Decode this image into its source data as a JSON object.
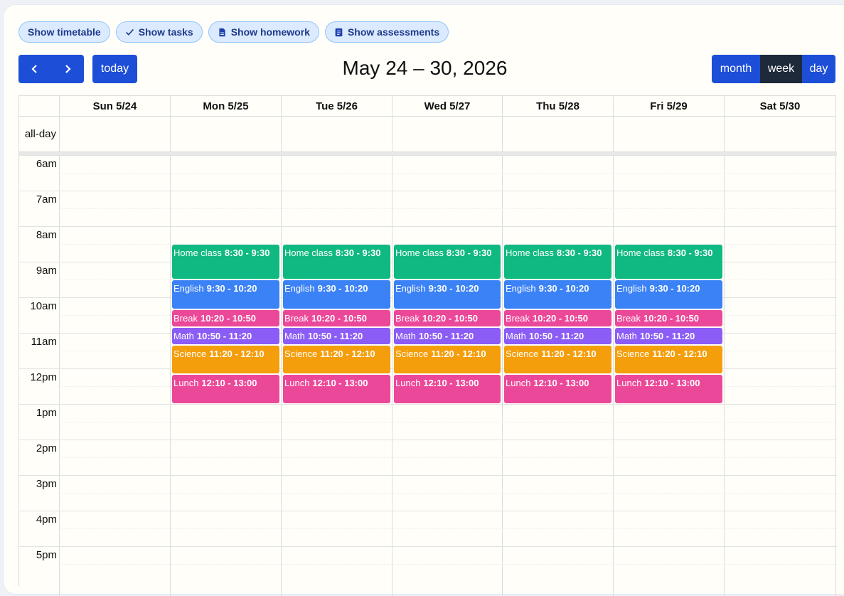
{
  "filters": [
    {
      "label": "Show timetable",
      "icon": "none"
    },
    {
      "label": "Show tasks",
      "icon": "check-icon"
    },
    {
      "label": "Show homework",
      "icon": "document-icon"
    },
    {
      "label": "Show assessments",
      "icon": "clipboard-icon"
    }
  ],
  "toolbar": {
    "today_label": "today",
    "title": "May 24 – 30, 2026",
    "views": [
      "month",
      "week",
      "day"
    ],
    "active_view": "week"
  },
  "days": [
    "Sun 5/24",
    "Mon 5/25",
    "Tue 5/26",
    "Wed 5/27",
    "Thu 5/28",
    "Fri 5/29",
    "Sat 5/30"
  ],
  "allday_label": "all-day",
  "times": [
    "6am",
    "7am",
    "8am",
    "9am",
    "10am",
    "11am",
    "12pm",
    "1pm",
    "2pm",
    "3pm",
    "4pm",
    "5pm"
  ],
  "events": [
    {
      "title": "Home class",
      "time": "8:30 - 9:30",
      "start": 8.5,
      "end": 9.5,
      "color": "#10b981"
    },
    {
      "title": "English",
      "time": "9:30 - 10:20",
      "start": 9.5,
      "end": 10.333,
      "color": "#3b82f6"
    },
    {
      "title": "Break",
      "time": "10:20 - 10:50",
      "start": 10.333,
      "end": 10.833,
      "color": "#ec4899"
    },
    {
      "title": "Math",
      "time": "10:50 - 11:20",
      "start": 10.833,
      "end": 11.333,
      "color": "#8b5cf6"
    },
    {
      "title": "Science",
      "time": "11:20 - 12:10",
      "start": 11.333,
      "end": 12.167,
      "color": "#f59e0b"
    },
    {
      "title": "Lunch",
      "time": "12:10 - 13:00",
      "start": 12.167,
      "end": 13.0,
      "color": "#ec4899"
    }
  ],
  "event_days": [
    1,
    2,
    3,
    4,
    5
  ]
}
